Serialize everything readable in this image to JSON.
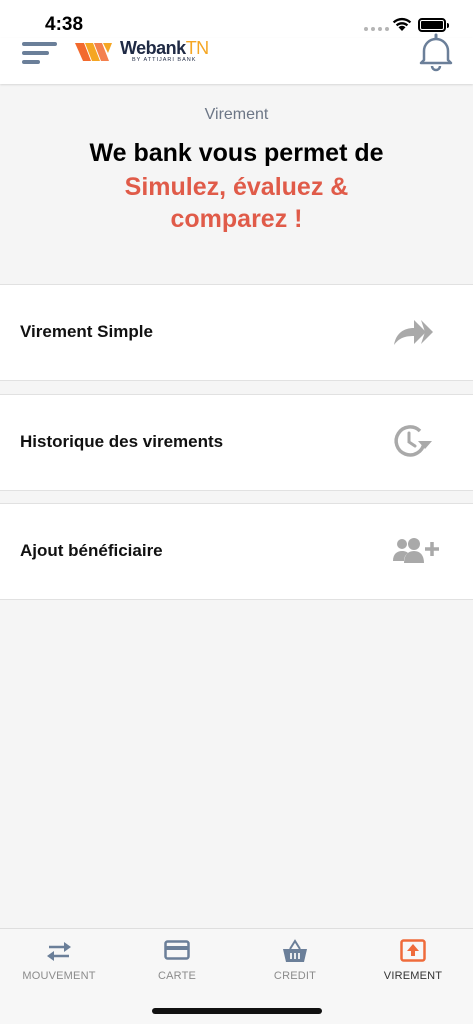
{
  "status_bar": {
    "time": "4:38"
  },
  "header": {
    "logo_text_main": "Webank",
    "logo_text_accent": "TN",
    "logo_subtitle": "BY ATTIJARI BANK"
  },
  "intro": {
    "label": "Virement",
    "title": "We bank vous permet de",
    "subtitle_line1": "Simulez, évaluez &",
    "subtitle_line2": "comparez !"
  },
  "menu": {
    "items": [
      {
        "label": "Virement Simple",
        "icon": "double-forward-arrow-icon"
      },
      {
        "label": "Historique des virements",
        "icon": "clock-history-icon"
      },
      {
        "label": "Ajout bénéficiaire",
        "icon": "add-users-icon"
      }
    ]
  },
  "tabbar": {
    "tabs": [
      {
        "label": "MOUVEMENT",
        "icon": "transfer-arrows-icon",
        "active": false
      },
      {
        "label": "CARTE",
        "icon": "credit-card-icon",
        "active": false
      },
      {
        "label": "CREDIT",
        "icon": "basket-icon",
        "active": false
      },
      {
        "label": "VIREMENT",
        "icon": "upload-icon",
        "active": true
      }
    ]
  },
  "colors": {
    "accent": "#e05b49",
    "brand_orange": "#f5a623",
    "menu_icon": "#6b7f99",
    "item_icon": "#a9a9a9",
    "active_tab_icon": "#ef6b3b"
  }
}
